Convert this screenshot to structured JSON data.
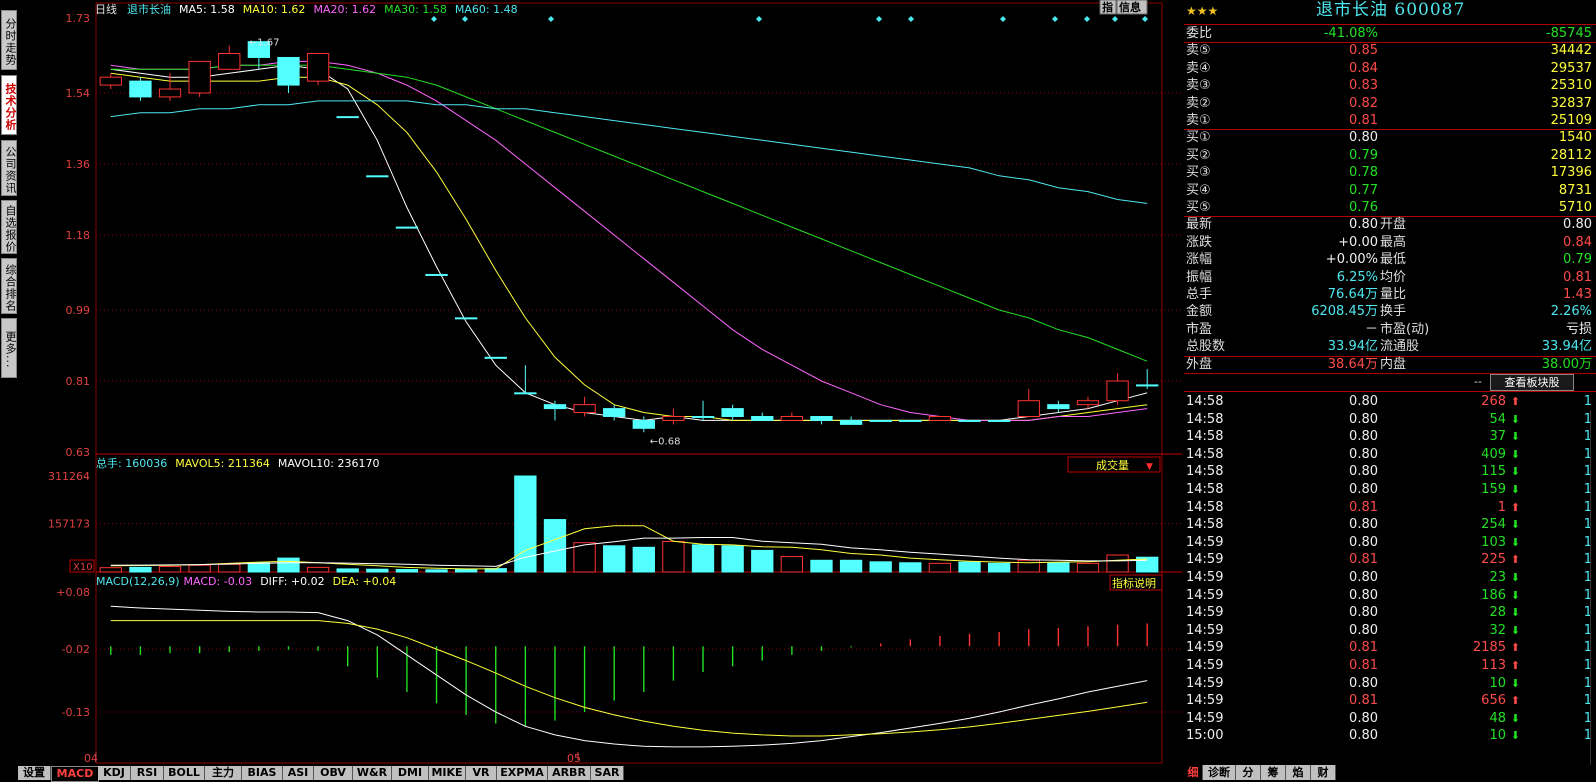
{
  "side_tabs": [
    "分时走势",
    "技术分析",
    "公司资讯",
    "自选报价",
    "综合排名",
    "更多..."
  ],
  "side_active": 1,
  "chart": {
    "period": "日线",
    "name": "退市长油",
    "ma": [
      {
        "label": "MA5: 1.58",
        "color": "#ffffff"
      },
      {
        "label": "MA10: 1.62",
        "color": "#ffff3c"
      },
      {
        "label": "MA20: 1.62",
        "color": "#ff66ff"
      },
      {
        "label": "MA30: 1.58",
        "color": "#22e022"
      },
      {
        "label": "MA60: 1.48",
        "color": "#4ee8f0"
      }
    ],
    "buttons": {
      "zhi": "指",
      "info": "信息"
    },
    "price_axis": [
      "1.73",
      "1.54",
      "1.36",
      "1.18",
      "0.99",
      "0.81",
      "0.63"
    ],
    "high_marker": "1.67",
    "low_marker": "0.68",
    "x_labels": [
      "04",
      "05"
    ],
    "candles": [
      {
        "o": 1.56,
        "c": 1.58,
        "h": 1.59,
        "l": 1.55
      },
      {
        "o": 1.57,
        "c": 1.53,
        "h": 1.58,
        "l": 1.52
      },
      {
        "o": 1.53,
        "c": 1.55,
        "h": 1.59,
        "l": 1.52
      },
      {
        "o": 1.54,
        "c": 1.62,
        "h": 1.62,
        "l": 1.53
      },
      {
        "o": 1.6,
        "c": 1.64,
        "h": 1.66,
        "l": 1.6
      },
      {
        "o": 1.67,
        "c": 1.63,
        "h": 1.67,
        "l": 1.6
      },
      {
        "o": 1.63,
        "c": 1.56,
        "h": 1.63,
        "l": 1.54
      },
      {
        "o": 1.57,
        "c": 1.64,
        "h": 1.64,
        "l": 1.56
      },
      {
        "o": 1.48,
        "c": 1.48,
        "h": 1.48,
        "l": 1.48
      },
      {
        "o": 1.33,
        "c": 1.33,
        "h": 1.33,
        "l": 1.33
      },
      {
        "o": 1.2,
        "c": 1.2,
        "h": 1.2,
        "l": 1.2
      },
      {
        "o": 1.08,
        "c": 1.08,
        "h": 1.08,
        "l": 1.08
      },
      {
        "o": 0.97,
        "c": 0.97,
        "h": 0.97,
        "l": 0.97
      },
      {
        "o": 0.87,
        "c": 0.87,
        "h": 0.87,
        "l": 0.87
      },
      {
        "o": 0.78,
        "c": 0.78,
        "h": 0.85,
        "l": 0.78
      },
      {
        "o": 0.75,
        "c": 0.74,
        "h": 0.76,
        "l": 0.71
      },
      {
        "o": 0.73,
        "c": 0.75,
        "h": 0.77,
        "l": 0.72
      },
      {
        "o": 0.74,
        "c": 0.72,
        "h": 0.75,
        "l": 0.71
      },
      {
        "o": 0.71,
        "c": 0.69,
        "h": 0.72,
        "l": 0.68
      },
      {
        "o": 0.71,
        "c": 0.72,
        "h": 0.74,
        "l": 0.7
      },
      {
        "o": 0.72,
        "c": 0.72,
        "h": 0.76,
        "l": 0.71
      },
      {
        "o": 0.74,
        "c": 0.72,
        "h": 0.75,
        "l": 0.71
      },
      {
        "o": 0.72,
        "c": 0.71,
        "h": 0.73,
        "l": 0.71
      },
      {
        "o": 0.71,
        "c": 0.72,
        "h": 0.73,
        "l": 0.71
      },
      {
        "o": 0.72,
        "c": 0.71,
        "h": 0.72,
        "l": 0.7
      },
      {
        "o": 0.71,
        "c": 0.7,
        "h": 0.72,
        "l": 0.7
      },
      {
        "o": 0.71,
        "c": 0.71,
        "h": 0.71,
        "l": 0.71
      },
      {
        "o": 0.71,
        "c": 0.71,
        "h": 0.71,
        "l": 0.71
      },
      {
        "o": 0.71,
        "c": 0.72,
        "h": 0.72,
        "l": 0.71
      },
      {
        "o": 0.71,
        "c": 0.71,
        "h": 0.71,
        "l": 0.71
      },
      {
        "o": 0.71,
        "c": 0.71,
        "h": 0.71,
        "l": 0.71
      },
      {
        "o": 0.72,
        "c": 0.76,
        "h": 0.79,
        "l": 0.72
      },
      {
        "o": 0.75,
        "c": 0.74,
        "h": 0.76,
        "l": 0.73
      },
      {
        "o": 0.75,
        "c": 0.76,
        "h": 0.77,
        "l": 0.74
      },
      {
        "o": 0.76,
        "c": 0.81,
        "h": 0.83,
        "l": 0.75
      },
      {
        "o": 0.8,
        "c": 0.8,
        "h": 0.84,
        "l": 0.79
      }
    ],
    "ma_lines": {
      "ma5": [
        1.6,
        1.59,
        1.58,
        1.58,
        1.59,
        1.6,
        1.61,
        1.6,
        1.55,
        1.42,
        1.25,
        1.1,
        0.96,
        0.85,
        0.78,
        0.75,
        0.73,
        0.72,
        0.71,
        0.72,
        0.71,
        0.71,
        0.71,
        0.71,
        0.71,
        0.71,
        0.71,
        0.71,
        0.71,
        0.71,
        0.71,
        0.72,
        0.73,
        0.74,
        0.76,
        0.78
      ],
      "ma10": [
        1.59,
        1.58,
        1.57,
        1.57,
        1.57,
        1.57,
        1.58,
        1.58,
        1.56,
        1.51,
        1.44,
        1.34,
        1.22,
        1.09,
        0.97,
        0.87,
        0.8,
        0.75,
        0.73,
        0.72,
        0.72,
        0.71,
        0.71,
        0.71,
        0.71,
        0.71,
        0.71,
        0.71,
        0.71,
        0.71,
        0.71,
        0.71,
        0.72,
        0.73,
        0.74,
        0.75
      ],
      "ma20": [
        1.61,
        1.6,
        1.6,
        1.6,
        1.61,
        1.61,
        1.62,
        1.62,
        1.61,
        1.59,
        1.56,
        1.52,
        1.47,
        1.42,
        1.36,
        1.3,
        1.24,
        1.18,
        1.12,
        1.06,
        1.0,
        0.94,
        0.89,
        0.85,
        0.81,
        0.78,
        0.75,
        0.73,
        0.72,
        0.71,
        0.71,
        0.71,
        0.72,
        0.72,
        0.73,
        0.74
      ],
      "ma30": [
        1.6,
        1.6,
        1.6,
        1.6,
        1.61,
        1.61,
        1.61,
        1.61,
        1.6,
        1.59,
        1.58,
        1.56,
        1.53,
        1.5,
        1.47,
        1.44,
        1.41,
        1.38,
        1.35,
        1.32,
        1.29,
        1.26,
        1.23,
        1.2,
        1.17,
        1.14,
        1.11,
        1.08,
        1.05,
        1.02,
        0.99,
        0.97,
        0.94,
        0.92,
        0.89,
        0.86
      ],
      "ma60": [
        1.48,
        1.49,
        1.49,
        1.5,
        1.5,
        1.51,
        1.51,
        1.52,
        1.52,
        1.52,
        1.52,
        1.51,
        1.51,
        1.5,
        1.5,
        1.49,
        1.48,
        1.47,
        1.46,
        1.45,
        1.44,
        1.43,
        1.42,
        1.41,
        1.4,
        1.39,
        1.38,
        1.37,
        1.36,
        1.35,
        1.33,
        1.32,
        1.3,
        1.29,
        1.27,
        1.26
      ]
    },
    "volume": {
      "header": {
        "total": "总手: 160036",
        "mavol5": "MAVOL5: 211364",
        "mavol10": "MAVOL10: 236170"
      },
      "dropdown": "成交量",
      "axis": [
        "311264",
        "157173",
        "X10"
      ],
      "values": [
        14000,
        15000,
        18000,
        22000,
        25000,
        30000,
        45000,
        15000,
        10000,
        9000,
        8000,
        7000,
        9000,
        11000,
        311264,
        170000,
        95000,
        85000,
        80000,
        99000,
        88000,
        85000,
        70000,
        50000,
        38000,
        38000,
        33000,
        30000,
        28000,
        32000,
        28000,
        38000,
        30000,
        28000,
        55000,
        48000
      ],
      "mavol5": [
        20000,
        21000,
        22000,
        24000,
        28000,
        32000,
        35000,
        30000,
        25000,
        20000,
        15000,
        12000,
        10000,
        10000,
        70000,
        105000,
        140000,
        150000,
        150000,
        100000,
        90000,
        88000,
        82000,
        80000,
        72000,
        60000,
        55000,
        45000,
        40000,
        35000,
        32000,
        30000,
        32000,
        33000,
        38000,
        42000
      ],
      "mavol10": [
        22000,
        22500,
        23000,
        24000,
        26000,
        28000,
        30000,
        30000,
        29000,
        27000,
        25000,
        22000,
        20000,
        18000,
        48000,
        68000,
        88000,
        98000,
        110000,
        110000,
        112000,
        112000,
        100000,
        95000,
        90000,
        78000,
        72000,
        64000,
        58000,
        52000,
        45000,
        40000,
        38000,
        36000,
        36000,
        38000
      ]
    },
    "macd": {
      "header": {
        "name": "MACD(12,26,9)",
        "macd": "MACD: -0.03",
        "diff": "DIFF: +0.02",
        "dea": "DEA: +0.04"
      },
      "explain": "指标说明",
      "axis": [
        "+0.08",
        "-0.02",
        "-0.13"
      ],
      "bars": [
        -0.015,
        -0.015,
        -0.012,
        -0.012,
        -0.01,
        -0.008,
        -0.006,
        -0.008,
        -0.035,
        -0.055,
        -0.08,
        -0.1,
        -0.12,
        -0.135,
        -0.14,
        -0.13,
        -0.115,
        -0.095,
        -0.08,
        -0.06,
        -0.045,
        -0.035,
        -0.025,
        -0.015,
        -0.008,
        -0.002,
        0.005,
        0.012,
        0.018,
        0.022,
        0.025,
        0.03,
        0.032,
        0.035,
        0.038,
        0.04
      ],
      "diff": [
        0.055,
        0.052,
        0.05,
        0.048,
        0.046,
        0.045,
        0.045,
        0.044,
        0.03,
        0.005,
        -0.03,
        -0.065,
        -0.1,
        -0.13,
        -0.155,
        -0.17,
        -0.18,
        -0.186,
        -0.19,
        -0.191,
        -0.191,
        -0.19,
        -0.188,
        -0.185,
        -0.18,
        -0.173,
        -0.166,
        -0.158,
        -0.15,
        -0.141,
        -0.13,
        -0.118,
        -0.107,
        -0.095,
        -0.085,
        -0.075
      ],
      "dea": [
        0.03,
        0.03,
        0.03,
        0.03,
        0.03,
        0.03,
        0.03,
        0.03,
        0.025,
        0.015,
        0.0,
        -0.02,
        -0.04,
        -0.062,
        -0.085,
        -0.105,
        -0.122,
        -0.135,
        -0.146,
        -0.155,
        -0.162,
        -0.167,
        -0.17,
        -0.172,
        -0.172,
        -0.17,
        -0.168,
        -0.165,
        -0.161,
        -0.156,
        -0.15,
        -0.143,
        -0.136,
        -0.129,
        -0.121,
        -0.113
      ]
    }
  },
  "bottom_tabs": [
    "设置",
    "MACD",
    "KDJ",
    "RSI",
    "BOLL",
    "主力",
    "BIAS",
    "ASI",
    "OBV",
    "W&R",
    "DMI",
    "MIKE",
    "VR",
    "EXPMA",
    "ARBR",
    "SAR"
  ],
  "bottom_active": 1,
  "stock": {
    "title": "退市长油 600087"
  },
  "orderbook": {
    "weibi": {
      "label": "委比",
      "pct": "-41.08%",
      "diff": "-85745"
    },
    "sells": [
      {
        "label": "卖⑤",
        "price": "0.85",
        "vol": "34442"
      },
      {
        "label": "卖④",
        "price": "0.84",
        "vol": "29537"
      },
      {
        "label": "卖③",
        "price": "0.83",
        "vol": "25310"
      },
      {
        "label": "卖②",
        "price": "0.82",
        "vol": "32837"
      },
      {
        "label": "卖①",
        "price": "0.81",
        "vol": "25109"
      }
    ],
    "buys": [
      {
        "label": "买①",
        "price": "0.80",
        "vol": "1540"
      },
      {
        "label": "买②",
        "price": "0.79",
        "vol": "28112"
      },
      {
        "label": "买③",
        "price": "0.78",
        "vol": "17396"
      },
      {
        "label": "买④",
        "price": "0.77",
        "vol": "8731"
      },
      {
        "label": "买⑤",
        "price": "0.76",
        "vol": "5710"
      }
    ]
  },
  "stats": [
    {
      "l1": "最新",
      "v1": "0.80",
      "c1": "white",
      "l2": "开盘",
      "v2": "0.80",
      "c2": "white"
    },
    {
      "l1": "涨跌",
      "v1": "+0.00",
      "c1": "white",
      "l2": "最高",
      "v2": "0.84",
      "c2": "red"
    },
    {
      "l1": "涨幅",
      "v1": "+0.00%",
      "c1": "white",
      "l2": "最低",
      "v2": "0.79",
      "c2": "green"
    },
    {
      "l1": "振幅",
      "v1": "6.25%",
      "c1": "cyan",
      "l2": "均价",
      "v2": "0.81",
      "c2": "red"
    },
    {
      "l1": "总手",
      "v1": "76.64万",
      "c1": "cyan",
      "l2": "量比",
      "v2": "1.43",
      "c2": "red"
    },
    {
      "l1": "金额",
      "v1": "6208.45万",
      "c1": "cyan",
      "l2": "换手",
      "v2": "2.26%",
      "c2": "cyan"
    },
    {
      "l1": "市盈",
      "v1": "－",
      "c1": "white",
      "l2": "市盈(动)",
      "v2": "亏损",
      "c2": "white"
    },
    {
      "l1": "总股数",
      "v1": "33.94亿",
      "c1": "cyan",
      "l2": "流通股",
      "v2": "33.94亿",
      "c2": "cyan"
    },
    {
      "l1": "外盘",
      "v1": "38.64万",
      "c1": "red",
      "l2": "内盘",
      "v2": "38.00万",
      "c2": "green"
    }
  ],
  "sector_button": "查看板块股",
  "ticks": [
    {
      "time": "14:58",
      "price": "0.80",
      "pc": "white",
      "vol": "268",
      "dir": "up",
      "n": "1"
    },
    {
      "time": "14:58",
      "price": "0.80",
      "pc": "white",
      "vol": "54",
      "dir": "down",
      "n": "1"
    },
    {
      "time": "14:58",
      "price": "0.80",
      "pc": "white",
      "vol": "37",
      "dir": "down",
      "n": "1"
    },
    {
      "time": "14:58",
      "price": "0.80",
      "pc": "white",
      "vol": "409",
      "dir": "down",
      "n": "1"
    },
    {
      "time": "14:58",
      "price": "0.80",
      "pc": "white",
      "vol": "115",
      "dir": "down",
      "n": "1"
    },
    {
      "time": "14:58",
      "price": "0.80",
      "pc": "white",
      "vol": "159",
      "dir": "down",
      "n": "1"
    },
    {
      "time": "14:58",
      "price": "0.81",
      "pc": "red",
      "vol": "1",
      "dir": "up",
      "n": "1"
    },
    {
      "time": "14:58",
      "price": "0.80",
      "pc": "white",
      "vol": "254",
      "dir": "down",
      "n": "1"
    },
    {
      "time": "14:59",
      "price": "0.80",
      "pc": "white",
      "vol": "103",
      "dir": "down",
      "n": "1"
    },
    {
      "time": "14:59",
      "price": "0.81",
      "pc": "red",
      "vol": "225",
      "dir": "up",
      "n": "1"
    },
    {
      "time": "14:59",
      "price": "0.80",
      "pc": "white",
      "vol": "23",
      "dir": "down",
      "n": "1"
    },
    {
      "time": "14:59",
      "price": "0.80",
      "pc": "white",
      "vol": "186",
      "dir": "down",
      "n": "1"
    },
    {
      "time": "14:59",
      "price": "0.80",
      "pc": "white",
      "vol": "28",
      "dir": "down",
      "n": "1"
    },
    {
      "time": "14:59",
      "price": "0.80",
      "pc": "white",
      "vol": "32",
      "dir": "down",
      "n": "1"
    },
    {
      "time": "14:59",
      "price": "0.81",
      "pc": "red",
      "vol": "2185",
      "dir": "up",
      "n": "1"
    },
    {
      "time": "14:59",
      "price": "0.81",
      "pc": "red",
      "vol": "113",
      "dir": "up",
      "n": "1"
    },
    {
      "time": "14:59",
      "price": "0.80",
      "pc": "white",
      "vol": "10",
      "dir": "down",
      "n": "1"
    },
    {
      "time": "14:59",
      "price": "0.81",
      "pc": "red",
      "vol": "656",
      "dir": "up",
      "n": "1"
    },
    {
      "time": "14:59",
      "price": "0.80",
      "pc": "white",
      "vol": "48",
      "dir": "down",
      "n": "1"
    },
    {
      "time": "15:00",
      "price": "0.80",
      "pc": "white",
      "vol": "10",
      "dir": "down",
      "n": "1"
    }
  ],
  "right_bottom_tabs": [
    "细",
    "诊断",
    "分",
    "筹",
    "焰",
    "财"
  ],
  "right_bottom_active": 0,
  "colors": {
    "up": "#ff3232",
    "down": "#54ffff",
    "grid": "#8b0000",
    "axis": "#b00000"
  }
}
